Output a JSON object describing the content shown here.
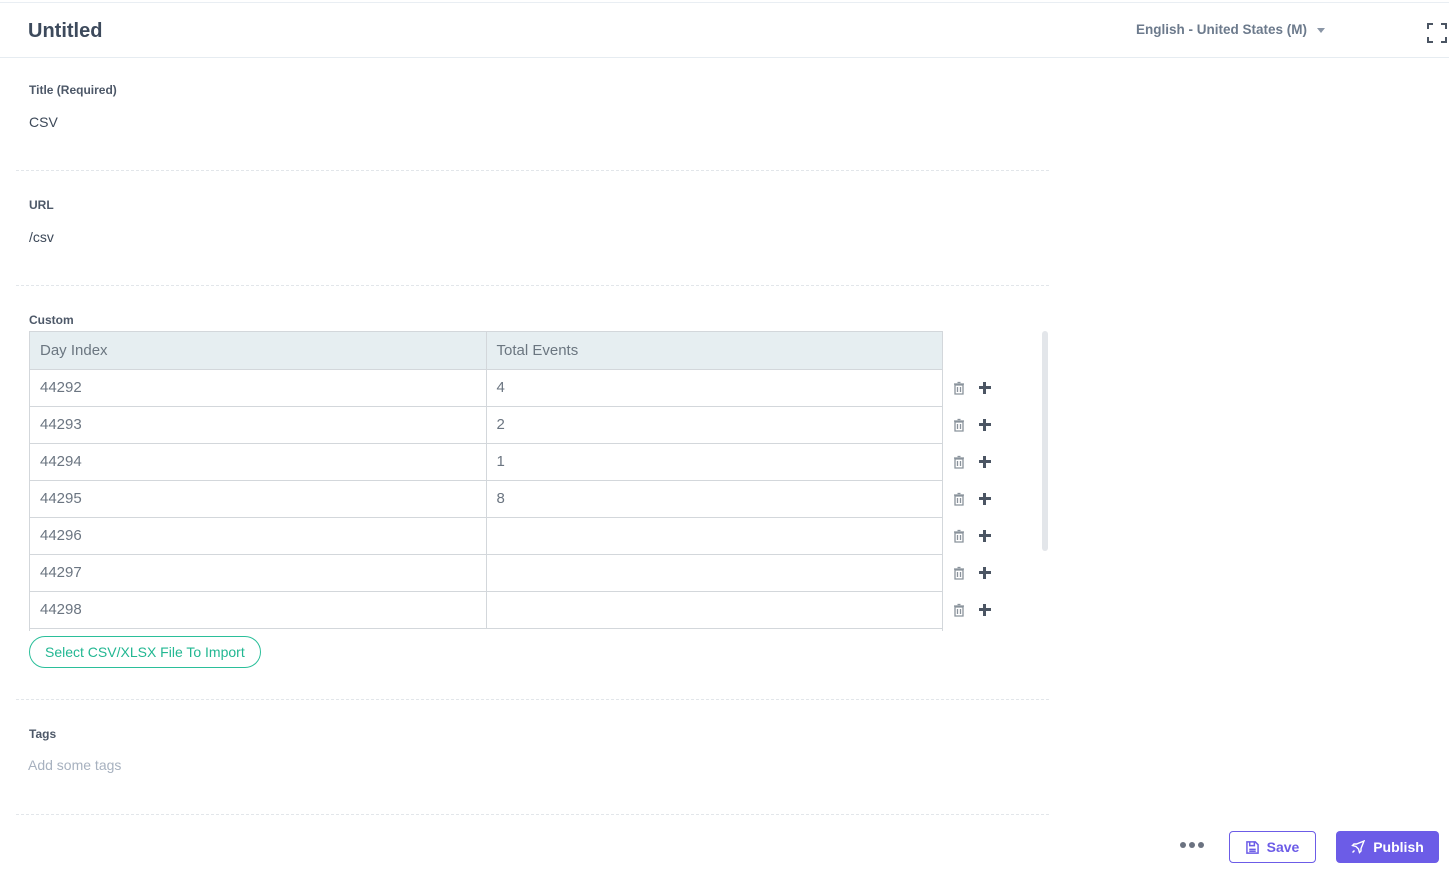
{
  "header": {
    "title": "Untitled",
    "language": "English - United States (M)"
  },
  "fields": {
    "title": {
      "label": "Title (Required)",
      "value": "CSV"
    },
    "url": {
      "label": "URL",
      "value": "/csv"
    },
    "custom": {
      "label": "Custom",
      "columns": [
        "Day Index",
        "Total Events"
      ],
      "rows": [
        [
          "44292",
          "4"
        ],
        [
          "44293",
          "2"
        ],
        [
          "44294",
          "1"
        ],
        [
          "44295",
          "8"
        ],
        [
          "44296",
          ""
        ],
        [
          "44297",
          ""
        ],
        [
          "44298",
          ""
        ]
      ],
      "import_label": "Select CSV/XLSX File To Import"
    },
    "tags": {
      "label": "Tags",
      "placeholder": "Add some tags"
    }
  },
  "footer": {
    "save_label": "Save",
    "publish_label": "Publish"
  },
  "icons": {
    "language_dropdown": "chevron-down-icon",
    "expand": "fullscreen-icon",
    "row_delete": "trash-icon",
    "row_add": "plus-icon",
    "more": "more-horizontal-icon",
    "save": "floppy-disk-icon",
    "publish": "rocket-icon"
  },
  "colors": {
    "accent": "#6c5ce7",
    "import_green": "#22b792",
    "table_header_bg": "#e6eef1"
  }
}
